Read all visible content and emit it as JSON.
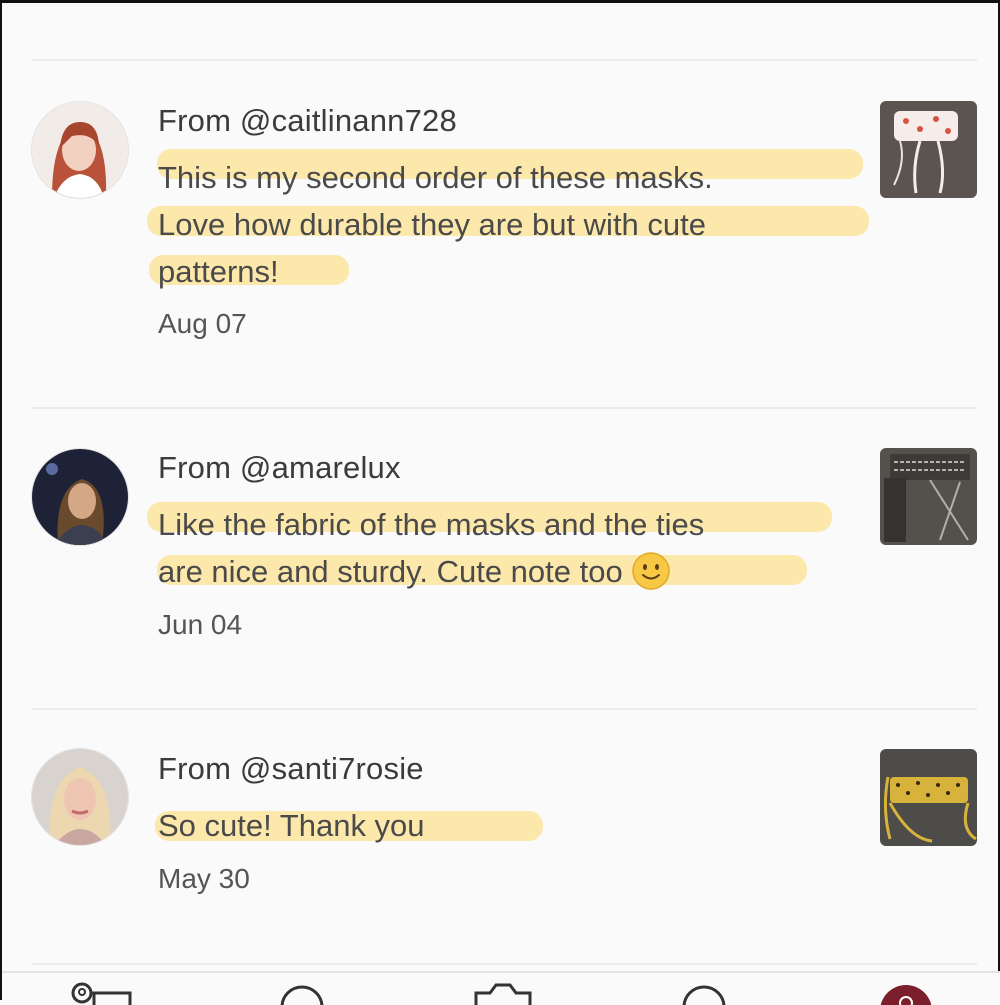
{
  "reviews": [
    {
      "from": "From @caitlinann728",
      "lines": [
        "This is my second order of these masks.",
        "Love how durable they are but with cute",
        "patterns!"
      ],
      "date": "Aug 07",
      "avatar_icon": "reviewer-avatar",
      "thumb_icon": "product-photo"
    },
    {
      "from": "From @amarelux",
      "lines": [
        "Like the fabric of the masks and the ties",
        "are nice and sturdy. Cute note too"
      ],
      "emoji": "slightly-smiling-face-emoji",
      "date": "Jun 04",
      "avatar_icon": "reviewer-avatar",
      "thumb_icon": "product-photo"
    },
    {
      "from": "From @santi7rosie",
      "lines": [
        "So cute! Thank you"
      ],
      "date": "May 30",
      "avatar_icon": "reviewer-avatar",
      "thumb_icon": "product-photo"
    }
  ],
  "tabbar": {
    "icons": [
      "you-icon",
      "home-icon",
      "camera-icon",
      "search-icon",
      "notification-badge-icon"
    ]
  },
  "colors": {
    "highlight": "#fde08c",
    "accent": "#7a1f2b",
    "text": "#3b3b3b"
  }
}
